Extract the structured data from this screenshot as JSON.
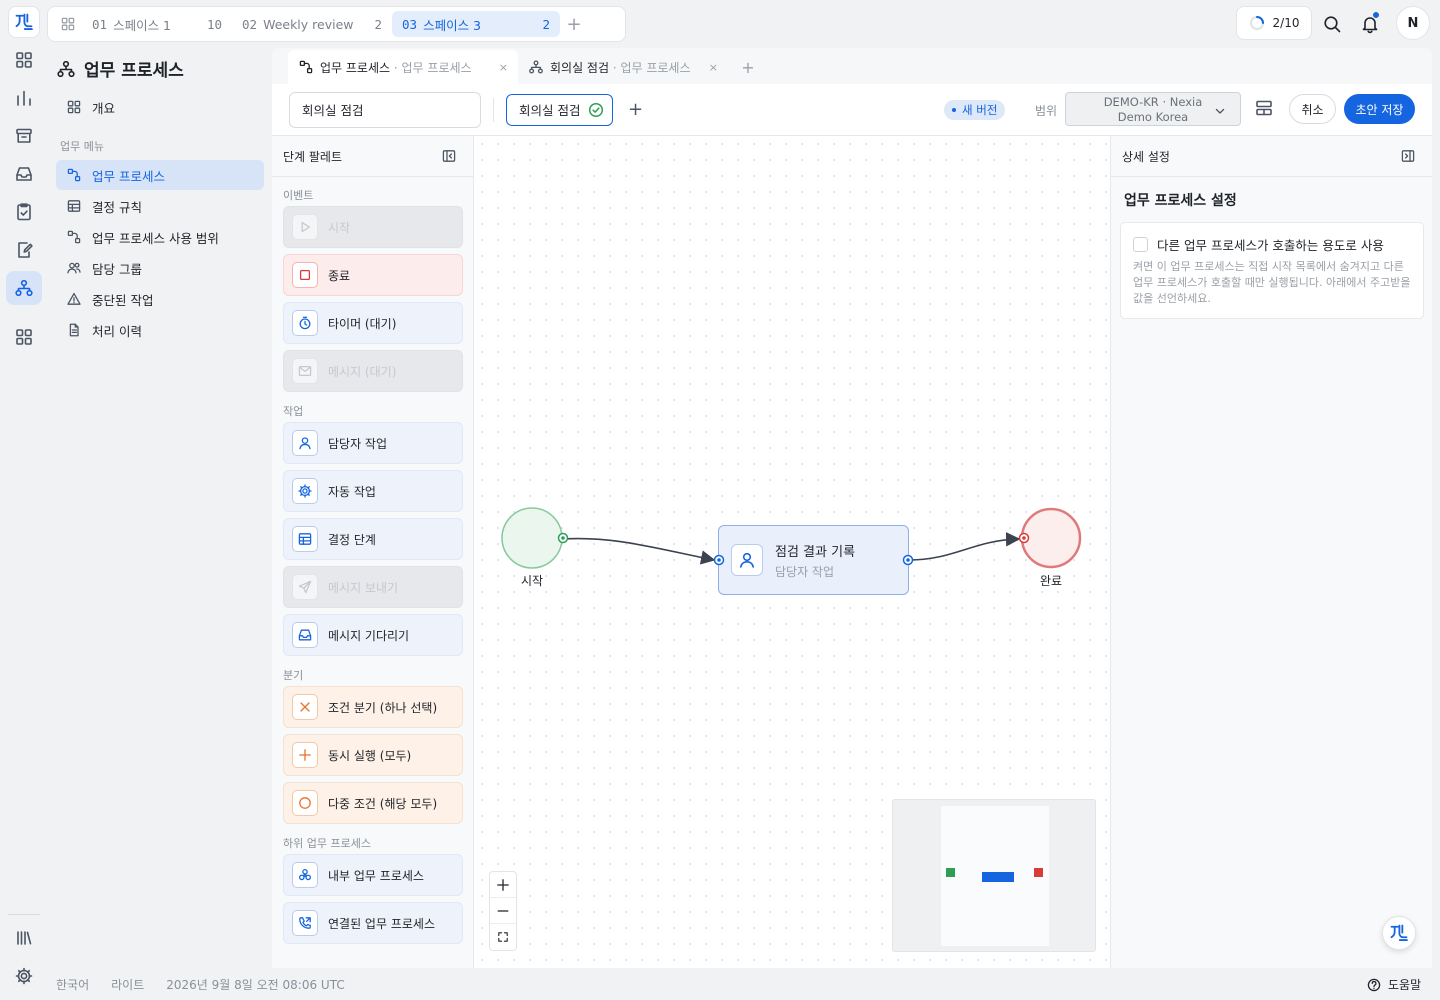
{
  "top_tabs": [
    {
      "num": "01",
      "label": "스페이스 1",
      "count": "10"
    },
    {
      "num": "02",
      "label": "Weekly review",
      "count": "2"
    },
    {
      "num": "03",
      "label": "스페이스 3",
      "count": "2"
    }
  ],
  "top_tabs_add": "+",
  "progress": "2/10",
  "avatar": "N",
  "nav": {
    "title": "업무 프로세스",
    "overview": "개요",
    "section": "업무 메뉴",
    "items": [
      "업무 프로세스",
      "결정 규칙",
      "업무 프로세스 사용 범위",
      "담당 그룹",
      "중단된 작업",
      "처리 이력"
    ]
  },
  "editor_tabs": [
    {
      "label": "업무 프로세스",
      "sub": " · 업무 프로세스"
    },
    {
      "label": "회의실 점검",
      "sub": " · 업무 프로세스"
    }
  ],
  "editor_tab_close": "×",
  "editor_tab_add": "+",
  "toolbar": {
    "name_value": "회의실 점검",
    "chip": "회의실 점검",
    "add": "+",
    "new_version": "새 버전",
    "scope_label": "범위",
    "scope_line1": "DEMO-KR · Nexia",
    "scope_line2": "Demo Korea",
    "cancel": "취소",
    "save": "초안 저장"
  },
  "palette": {
    "title": "단계 팔레트",
    "sections": {
      "events": "이벤트",
      "tasks": "작업",
      "gateways": "분기",
      "sub": "하위 업무 프로세스"
    },
    "items": [
      {
        "label": "시작",
        "icon": "play-icon",
        "style": "disabled"
      },
      {
        "label": "종료",
        "icon": "stop-icon",
        "style": "red"
      },
      {
        "label": "타이머 (대기)",
        "icon": "timer-icon",
        "style": "blue"
      },
      {
        "label": "메시지 (대기)",
        "icon": "mail-icon",
        "style": "disabled"
      },
      {
        "label": "담당자 작업",
        "icon": "user-icon",
        "style": "blue"
      },
      {
        "label": "자동 작업",
        "icon": "gear-icon",
        "style": "blue"
      },
      {
        "label": "결정 단계",
        "icon": "table-icon",
        "style": "blue"
      },
      {
        "label": "메시지 보내기",
        "icon": "send-icon",
        "style": "disabled"
      },
      {
        "label": "메시지 기다리기",
        "icon": "inbox-icon",
        "style": "blue"
      },
      {
        "label": "조건 분기 (하나 선택)",
        "icon": "x-icon",
        "style": "orange"
      },
      {
        "label": "동시 실행 (모두)",
        "icon": "plus-icon",
        "style": "orange"
      },
      {
        "label": "다중 조건 (해당 모두)",
        "icon": "circle-icon",
        "style": "orange"
      },
      {
        "label": "내부 업무 프로세스",
        "icon": "cluster-icon",
        "style": "blue"
      },
      {
        "label": "연결된 업무 프로세스",
        "icon": "call-icon",
        "style": "blue"
      }
    ]
  },
  "diagram": {
    "start_label": "시작",
    "end_label": "완료",
    "task_title": "점검 결과 기록",
    "task_type": "담당자 작업"
  },
  "details": {
    "header": "상세 설정",
    "title": "업무 프로세스 설정",
    "checkbox_label": "다른 업무 프로세스가 호출하는 용도로 사용",
    "description": "켜면 이 업무 프로세스는 직접 시작 목록에서 숨겨지고 다른 업무 프로세스가 호출할 때만 실행됩니다. 아래에서 주고받을 값을 선언하세요."
  },
  "footer": {
    "language": "한국어",
    "theme": "라이트",
    "timestamp": "2026년 9월 8일 오전 08:06 UTC",
    "help": "도움말"
  },
  "colors": {
    "accent": "#1565e0",
    "start": "#2e9e55",
    "end": "#d93a3a"
  }
}
